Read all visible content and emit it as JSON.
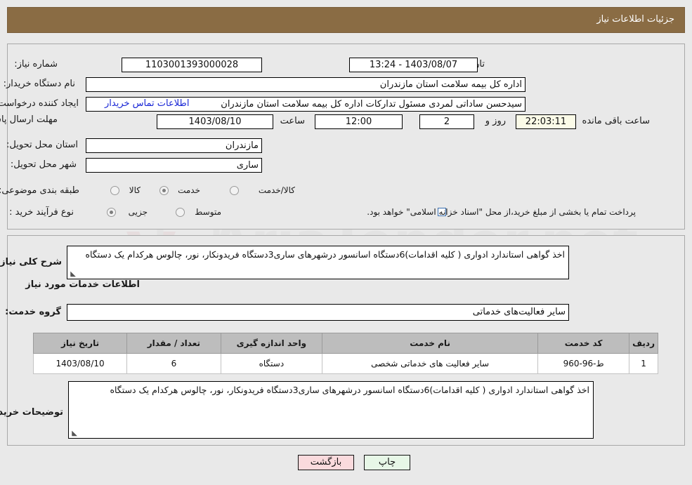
{
  "header": {
    "title": "جزئیات اطلاعات نیاز"
  },
  "fields": {
    "need_number_label": "شماره نیاز:",
    "need_number_value": "1103001393000028",
    "announce_label": "تاریخ و ساعت اعلان عمومی:",
    "announce_value": "1403/08/07 - 13:24",
    "buyer_org_label": "نام دستگاه خریدار:",
    "buyer_org_value": "اداره کل بیمه سلامت استان مازندران",
    "creator_label": "ایجاد کننده درخواست:",
    "creator_value": "سیدحسن ساداتی لمردی مسئول تدارکات اداره کل بیمه سلامت استان مازندران",
    "contact_link": "اطلاعات تماس خریدار",
    "deadline_label": "مهلت ارسال پاسخ: تا تاریخ:",
    "deadline_date": "1403/08/10",
    "hour_label": "ساعت",
    "deadline_time": "12:00",
    "days_value": "2",
    "days_label": "روز و",
    "countdown_value": "22:03:11",
    "countdown_label": "ساعت باقی مانده",
    "province_label": "استان محل تحویل:",
    "province_value": "مازندران",
    "city_label": "شهر محل تحویل:",
    "city_value": "ساری",
    "category_label": "طبقه بندی موضوعی:",
    "category_options": [
      "کالا",
      "خدمت",
      "کالا/خدمت"
    ],
    "category_selected": "خدمت",
    "process_label": "نوع فرآیند خرید :",
    "process_options": [
      "جزیی",
      "متوسط"
    ],
    "process_selected": "جزیی",
    "treasury_note": "پرداخت تمام یا بخشی از مبلغ خرید،از محل \"اسناد خزانه اسلامی\" خواهد بود."
  },
  "summary": {
    "label": "شرح کلی نیاز:",
    "text": "اخذ گواهی استاندارد ادواری ( کلیه اقدامات)6دستگاه اسانسور درشهرهای ساری3دستگاه فریدونکار، نور، چالوس هرکدام یک دستگاه"
  },
  "services_section": {
    "heading": "اطلاعات خدمات مورد نیاز",
    "group_label": "گروه خدمت:",
    "group_value": "سایر فعالیت‌های خدماتی"
  },
  "table": {
    "columns": [
      "ردیف",
      "کد خدمت",
      "نام خدمت",
      "واحد اندازه گیری",
      "تعداد / مقدار",
      "تاریخ نیاز"
    ],
    "rows": [
      {
        "row": "1",
        "service_code": "ط-96-960",
        "service_name": "سایر فعالیت های خدماتی شخصی",
        "unit": "دستگاه",
        "quantity": "6",
        "need_date": "1403/08/10"
      }
    ]
  },
  "buyer_notes": {
    "label": "توضیحات خریدار:",
    "text": "اخذ گواهی استاندارد ادواری ( کلیه اقدامات)6دستگاه اسانسور درشهرهای ساری3دستگاه فریدونکار، نور، چالوس هرکدام یک دستگاه"
  },
  "buttons": {
    "print": "چاپ",
    "back": "بازگشت"
  },
  "watermark": {
    "text": "AriaTender.net"
  },
  "colors": {
    "header_bar": "#8a6c44",
    "page_bg": "#e9e9e9",
    "link": "#1a27d6",
    "table_header": "#bdbdbd",
    "print_btn": "#e7f7e7",
    "back_btn": "#fadadd"
  }
}
